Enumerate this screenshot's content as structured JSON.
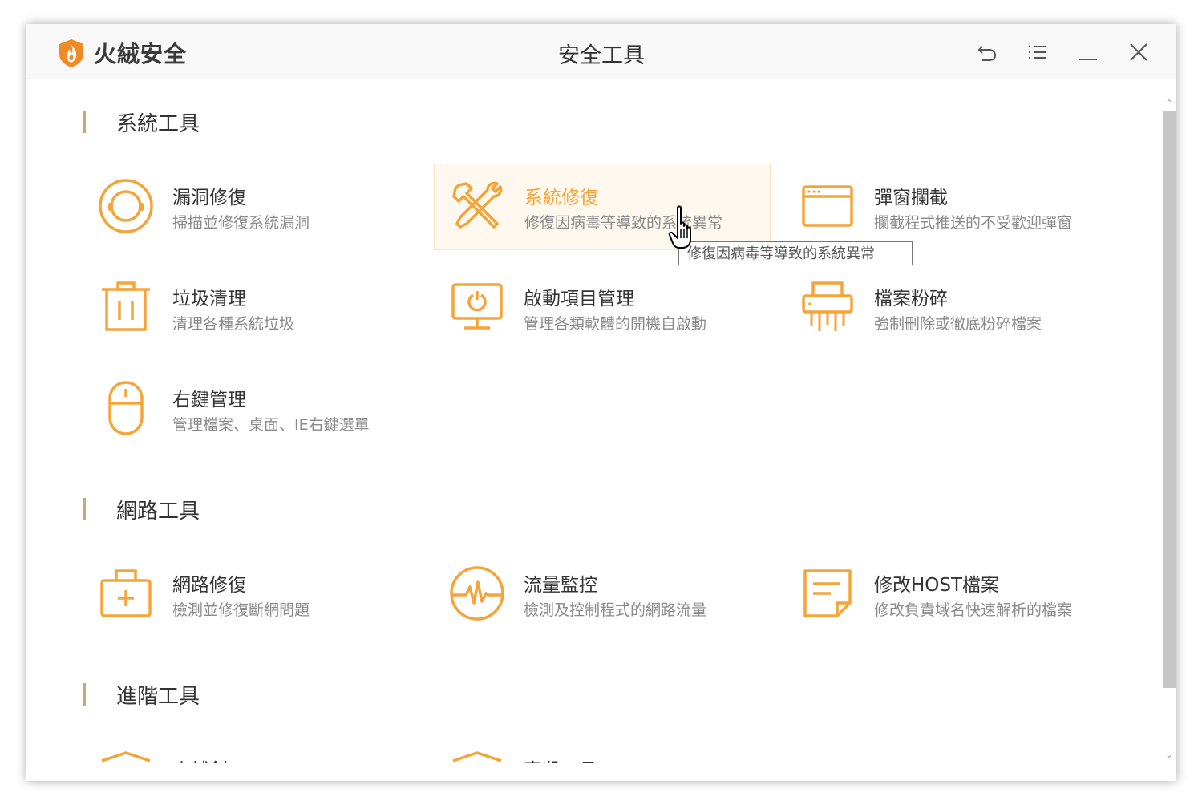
{
  "app": {
    "brand": "火絨安全",
    "window_title": "安全工具"
  },
  "colors": {
    "accent": "#f5a43a",
    "section_bar": "#c9a77a",
    "logo": "#f08a24"
  },
  "controls": [
    {
      "icon": "back-icon"
    },
    {
      "icon": "menu-icon"
    },
    {
      "icon": "minimize-icon"
    },
    {
      "icon": "close-icon"
    }
  ],
  "sections": {
    "system": "系統工具",
    "network": "網路工具",
    "advanced": "進階工具"
  },
  "system_tools": [
    {
      "title": "漏洞修復",
      "desc": "掃描並修復系統漏洞",
      "icon": "vulnerability-repair-icon"
    },
    {
      "title": "系統修復",
      "desc": "修復因病毒等導致的系統異常",
      "icon": "system-repair-icon"
    },
    {
      "title": "彈窗攔截",
      "desc": "攔截程式推送的不受歡迎彈窗",
      "icon": "popup-block-icon"
    },
    {
      "title": "垃圾清理",
      "desc": "清理各種系統垃圾",
      "icon": "trash-icon"
    },
    {
      "title": "啟動項目管理",
      "desc": "管理各類軟體的開機自啟動",
      "icon": "startup-icon"
    },
    {
      "title": "檔案粉碎",
      "desc": "強制刪除或徹底粉碎檔案",
      "icon": "shredder-icon"
    },
    {
      "title": "右鍵管理",
      "desc": "管理檔案、桌面、IE右鍵選單",
      "icon": "mouse-icon"
    }
  ],
  "network_tools": [
    {
      "title": "網路修復",
      "desc": "檢測並修復斷網問題",
      "icon": "network-repair-icon"
    },
    {
      "title": "流量監控",
      "desc": "檢測及控制程式的網路流量",
      "icon": "traffic-monitor-icon"
    },
    {
      "title": "修改HOST檔案",
      "desc": "修改負責域名快速解析的檔案",
      "icon": "host-file-icon"
    }
  ],
  "advanced_tools": [
    {
      "title": "火絨劍",
      "icon": "sword-icon"
    },
    {
      "title": "專殺工具",
      "icon": "kill-tool-icon"
    }
  ],
  "tooltip": "修復因病毒等導致的系統異常"
}
